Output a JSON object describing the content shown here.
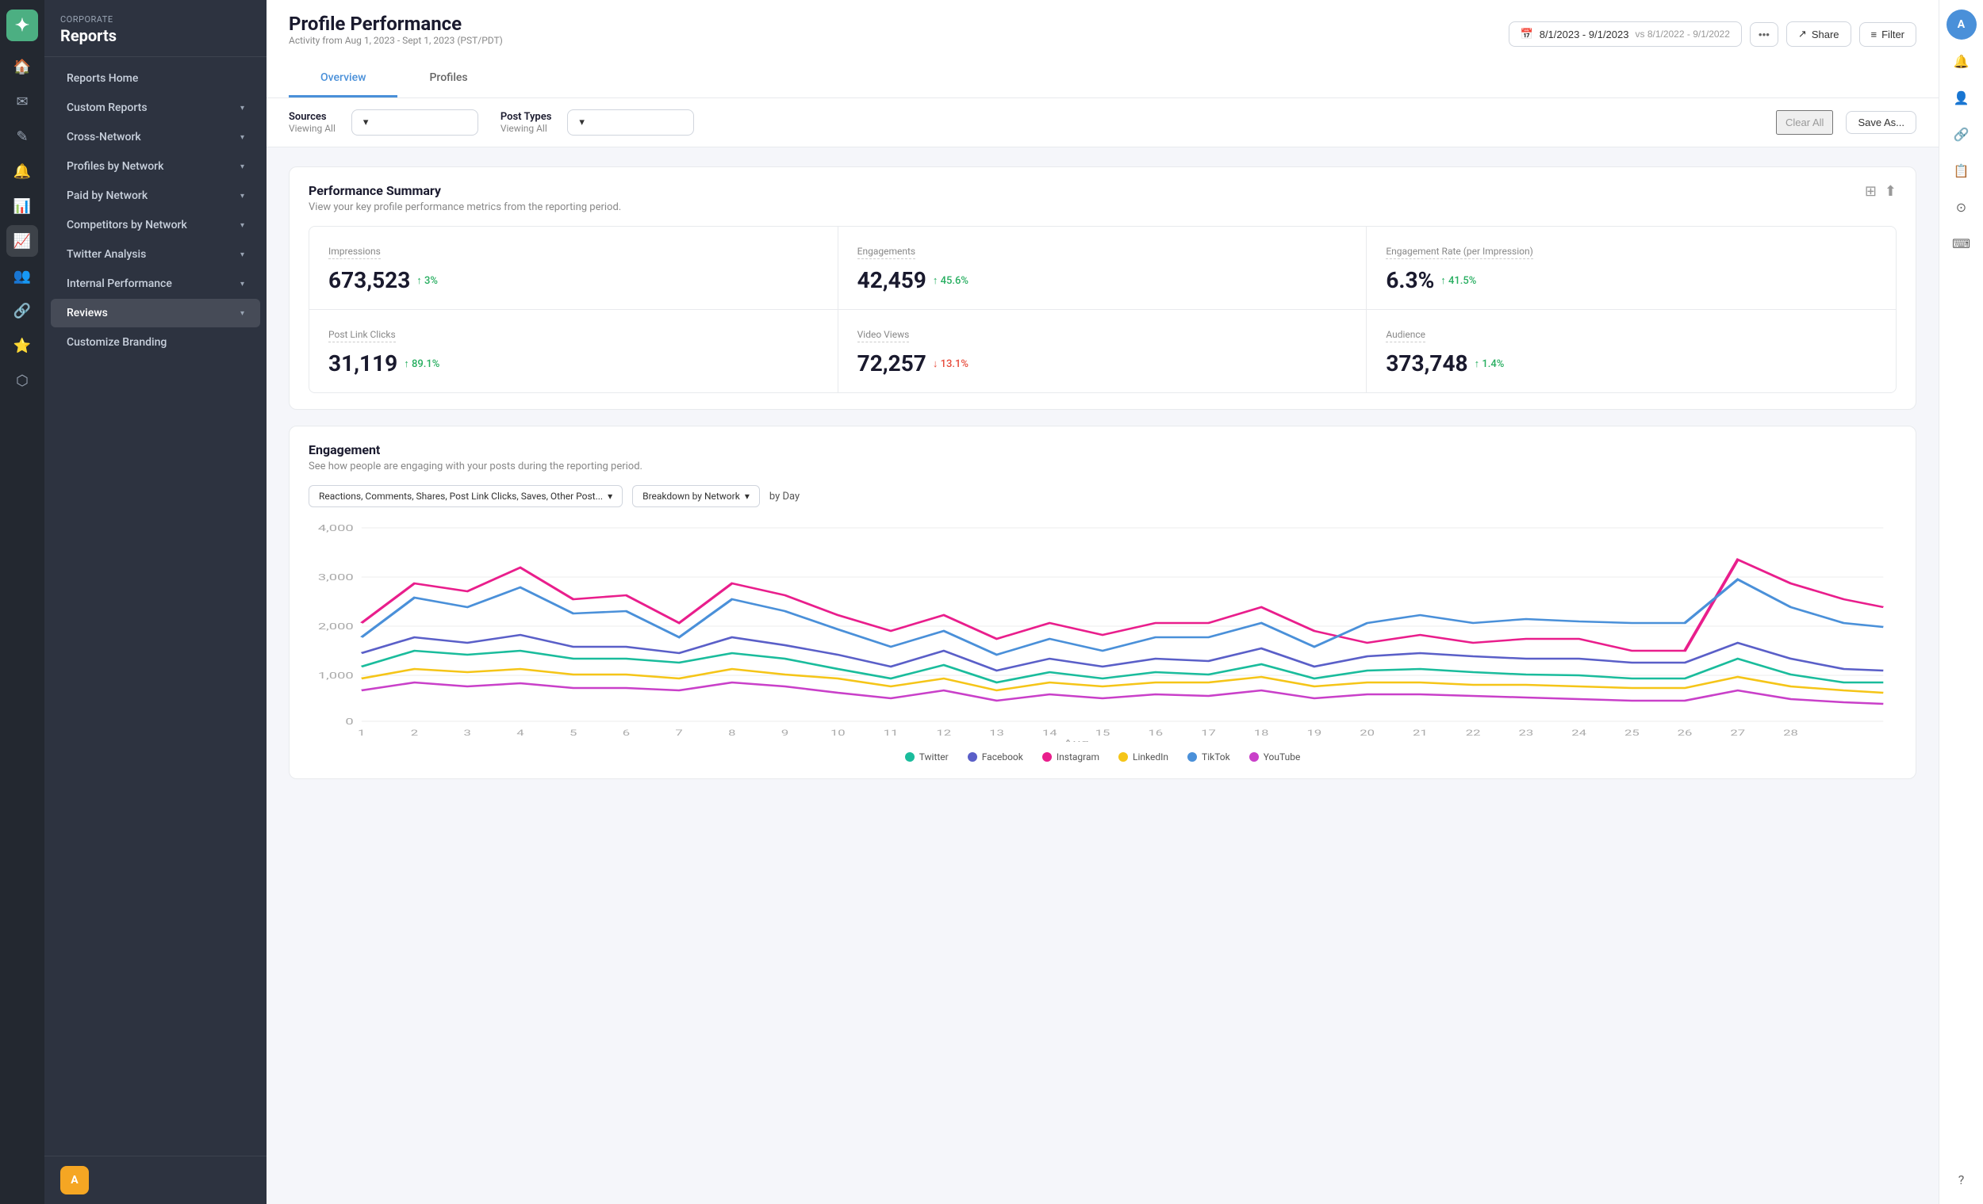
{
  "brand": {
    "sub": "Corporate",
    "title": "Reports"
  },
  "sidebar": {
    "items": [
      {
        "id": "reports-home",
        "label": "Reports Home",
        "hasChevron": false
      },
      {
        "id": "custom-reports",
        "label": "Custom Reports",
        "hasChevron": true
      },
      {
        "id": "cross-network",
        "label": "Cross-Network",
        "hasChevron": true
      },
      {
        "id": "profiles-by-network",
        "label": "Profiles by Network",
        "hasChevron": true
      },
      {
        "id": "paid-by-network",
        "label": "Paid by Network",
        "hasChevron": true
      },
      {
        "id": "competitors-by-network",
        "label": "Competitors by Network",
        "hasChevron": true
      },
      {
        "id": "twitter-analysis",
        "label": "Twitter Analysis",
        "hasChevron": true
      },
      {
        "id": "internal-performance",
        "label": "Internal Performance",
        "hasChevron": true
      },
      {
        "id": "reviews",
        "label": "Reviews",
        "hasChevron": true
      },
      {
        "id": "customize-branding",
        "label": "Customize Branding",
        "hasChevron": false
      }
    ]
  },
  "header": {
    "title": "Profile Performance",
    "activity": "Activity from Aug 1, 2023 - Sept 1, 2023 (PST/PDT)",
    "date_range": "8/1/2023 - 9/1/2023",
    "date_vs": "vs 8/1/2022 - 9/1/2022",
    "share_label": "Share",
    "filter_label": "Filter"
  },
  "tabs": [
    {
      "id": "overview",
      "label": "Overview",
      "active": true
    },
    {
      "id": "profiles",
      "label": "Profiles",
      "active": false
    }
  ],
  "filters": {
    "sources_label": "Sources",
    "sources_value": "Viewing All",
    "post_types_label": "Post Types",
    "post_types_value": "Viewing All",
    "clear_label": "Clear All",
    "save_as_label": "Save As..."
  },
  "performance_summary": {
    "title": "Performance Summary",
    "subtitle": "View your key profile performance metrics from the reporting period.",
    "metrics": [
      {
        "id": "impressions",
        "label": "Impressions",
        "value": "673,523",
        "change": "↑ 3%",
        "change_dir": "up"
      },
      {
        "id": "engagements",
        "label": "Engagements",
        "value": "42,459",
        "change": "↑ 45.6%",
        "change_dir": "up"
      },
      {
        "id": "engagement-rate",
        "label": "Engagement Rate (per Impression)",
        "value": "6.3%",
        "change": "↑ 41.5%",
        "change_dir": "up"
      },
      {
        "id": "post-link-clicks",
        "label": "Post Link Clicks",
        "value": "31,119",
        "change": "↑ 89.1%",
        "change_dir": "up"
      },
      {
        "id": "video-views",
        "label": "Video Views",
        "value": "72,257",
        "change": "↓ 13.1%",
        "change_dir": "down"
      },
      {
        "id": "audience",
        "label": "Audience",
        "value": "373,748",
        "change": "↑ 1.4%",
        "change_dir": "up"
      }
    ]
  },
  "engagement": {
    "title": "Engagement",
    "subtitle": "See how people are engaging with your posts during the reporting period.",
    "filter1": "Reactions, Comments, Shares, Post Link Clicks, Saves, Other Post...",
    "filter2": "Breakdown by Network",
    "filter3": "by Day",
    "y_labels": [
      "4,000",
      "3,000",
      "2,000",
      "1,000",
      "0"
    ],
    "x_labels": [
      "1",
      "2",
      "3",
      "4",
      "5",
      "6",
      "7",
      "8",
      "9",
      "10",
      "11",
      "12",
      "13",
      "14",
      "15",
      "16",
      "17",
      "18",
      "19",
      "20",
      "21",
      "22",
      "23",
      "24",
      "25",
      "26",
      "27",
      "28"
    ],
    "x_group_label": "Aug",
    "legend": [
      {
        "id": "twitter",
        "label": "Twitter",
        "color": "#1abc9c"
      },
      {
        "id": "facebook",
        "label": "Facebook",
        "color": "#5a5fc8"
      },
      {
        "id": "instagram",
        "label": "Instagram",
        "color": "#e91e8c"
      },
      {
        "id": "linkedin",
        "label": "LinkedIn",
        "color": "#f5c518"
      },
      {
        "id": "tiktok",
        "label": "TikTok",
        "color": "#4a90d9"
      },
      {
        "id": "youtube",
        "label": "YouTube",
        "color": "#c940c9"
      }
    ]
  },
  "right_rail": {
    "avatar_initials": "A"
  }
}
